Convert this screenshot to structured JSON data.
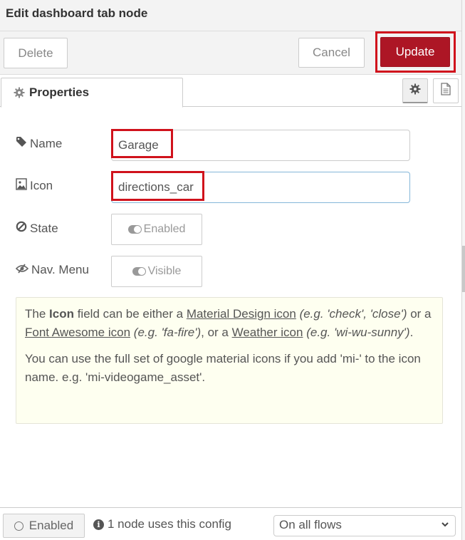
{
  "tray": {
    "title": "Edit dashboard tab node"
  },
  "toolbar": {
    "delete_label": "Delete",
    "cancel_label": "Cancel",
    "update_label": "Update",
    "update_color": "#ad1625",
    "highlight_color": "#d0121c"
  },
  "tabs": {
    "properties_label": "Properties",
    "properties_icon": "gear-icon",
    "side_buttons": [
      {
        "icon": "gear-icon",
        "active": true
      },
      {
        "icon": "document-icon",
        "active": false
      }
    ]
  },
  "form": {
    "name": {
      "label": "Name",
      "icon": "tag-icon",
      "value": "Garage"
    },
    "icon": {
      "label": "Icon",
      "icon": "image-icon",
      "value": "directions_car"
    },
    "state": {
      "label": "State",
      "icon": "ban-icon",
      "toggle_label": "Enabled"
    },
    "nav_menu": {
      "label": "Nav. Menu",
      "icon": "eye-slash-icon",
      "toggle_label": "Visible"
    }
  },
  "tip": {
    "p1_part1": "The ",
    "p1_bold": "Icon",
    "p1_part2": " field can be either a ",
    "link_material": "Material Design icon",
    "eg_material": "(e.g. 'check', 'close')",
    "p1_part3": " or a ",
    "link_fontawesome": "Font Awesome icon",
    "eg_fontawesome": "(e.g. 'fa-fire')",
    "p1_part4": ", or a ",
    "link_weather": "Weather icon",
    "eg_weather": "(e.g. 'wi-wu-sunny')",
    "p1_end": ".",
    "p2": "You can use the full set of google material icons if you add 'mi-' to the icon name. e.g. 'mi-videogame_asset'."
  },
  "footer": {
    "enabled_label": "Enabled",
    "usage_text": "1 node uses this config",
    "scope_selected": "On all flows"
  }
}
